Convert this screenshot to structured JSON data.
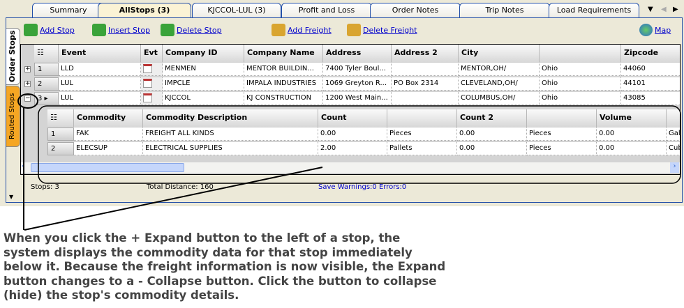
{
  "tabs": [
    "Summary",
    "AllStops (3)",
    "KJCCOL-LUL (3)",
    "Profit and Loss",
    "Order Notes",
    "Trip Notes",
    "Load Requirements"
  ],
  "side_tabs": [
    "Order Stops",
    "Routed Stops"
  ],
  "toolbar": {
    "add_stop": "Add Stop",
    "insert_stop": "Insert Stop",
    "delete_stop": "Delete Stop",
    "add_freight": "Add Freight",
    "delete_freight": "Delete Freight",
    "map": "Map"
  },
  "stops": {
    "columns": [
      "Event",
      "Evt",
      "Company ID",
      "Company Name",
      "Address",
      "Address 2",
      "City",
      "",
      "Zipcode"
    ],
    "rows": [
      {
        "n": "1",
        "expander": "+",
        "event": "LLD",
        "company_id": "MENMEN",
        "company_name": "MENTOR  BUILDIN...",
        "address": "7400 Tyler Boul...",
        "address2": "",
        "city": "MENTOR,OH/",
        "state": "Ohio",
        "zip": "44060"
      },
      {
        "n": "2",
        "expander": "+",
        "event": "LUL",
        "company_id": "IMPCLE",
        "company_name": "IMPALA INDUSTRIES",
        "address": "1069 Greyton R...",
        "address2": "PO Box 2314",
        "city": "CLEVELAND,OH/",
        "state": "Ohio",
        "zip": "44101"
      },
      {
        "n": "3",
        "expander": "−",
        "event": "LUL",
        "company_id": "KJCCOL",
        "company_name": "KJ CONSTRUCTION",
        "address": "1200 West Main...",
        "address2": "",
        "city": "COLUMBUS,OH/",
        "state": "Ohio",
        "zip": "43085"
      }
    ]
  },
  "commodities": {
    "columns": [
      "Commodity",
      "Commodity Description",
      "Count",
      "",
      "Count 2",
      "",
      "Volume",
      ""
    ],
    "rows": [
      {
        "n": "1",
        "c": [
          "FAK",
          "FREIGHT ALL KINDS",
          "0.00",
          "Pieces",
          "0.00",
          "Pieces",
          "0.00",
          "Gal"
        ]
      },
      {
        "n": "2",
        "c": [
          "ELECSUP",
          "ELECTRICAL SUPPLIES",
          "2.00",
          "Pallets",
          "0.00",
          "Pieces",
          "0.00",
          "Cub"
        ]
      }
    ]
  },
  "status": {
    "stops": "Stops: 3",
    "distance": "Total Distance: 160",
    "warnings": "Save Warnings:0 Errors:0"
  },
  "note": "When you click the + Expand button to the left of a stop, the system displays the commodity data for that stop immediately below it. Because the freight information is now visible, the Expand button changes to a - Collapse button. Click the button to collapse (hide) the stop's commodity details.",
  "colors": {
    "link": "#0000cc",
    "tab_border": "#2450a8",
    "active_tab": "#fbf3d5",
    "routed_tab": "#f5a623"
  }
}
